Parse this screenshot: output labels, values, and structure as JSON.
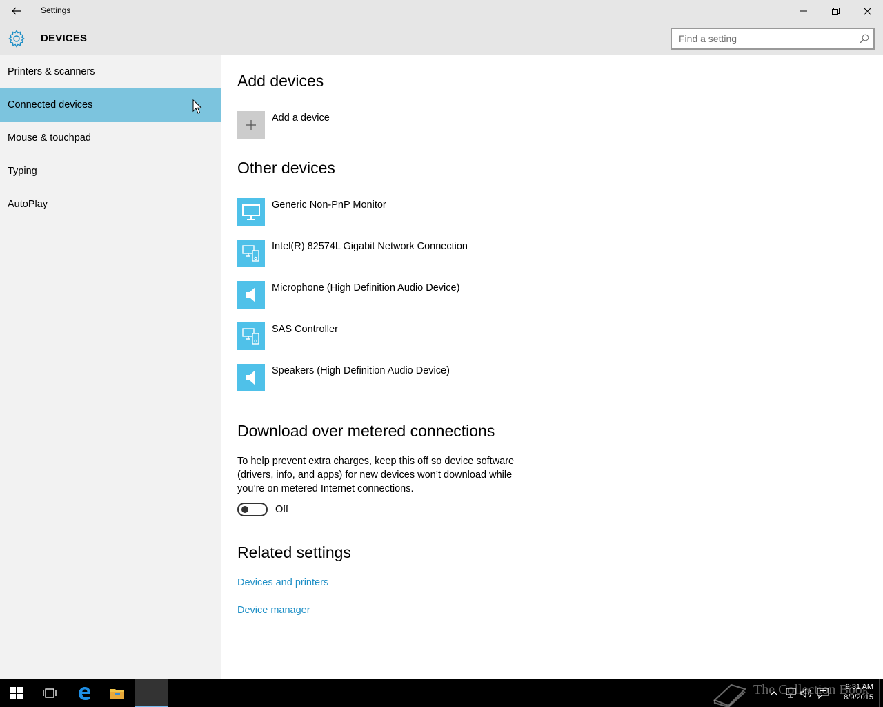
{
  "window": {
    "title": "Settings",
    "app_title": "DEVICES"
  },
  "search": {
    "placeholder": "Find a setting",
    "value": ""
  },
  "sidebar": {
    "items": [
      {
        "label": "Printers & scanners",
        "active": false
      },
      {
        "label": "Connected devices",
        "active": true
      },
      {
        "label": "Mouse & touchpad",
        "active": false
      },
      {
        "label": "Typing",
        "active": false
      },
      {
        "label": "AutoPlay",
        "active": false
      }
    ]
  },
  "main": {
    "add_devices": {
      "heading": "Add devices",
      "add_label": "Add a device"
    },
    "other_devices": {
      "heading": "Other devices",
      "devices": [
        {
          "name": "Generic Non-PnP Monitor",
          "icon": "monitor-icon"
        },
        {
          "name": "Intel(R) 82574L Gigabit Network Connection",
          "icon": "generic-device-icon"
        },
        {
          "name": "Microphone (High Definition Audio Device)",
          "icon": "speaker-icon"
        },
        {
          "name": "SAS Controller",
          "icon": "generic-device-icon"
        },
        {
          "name": "Speakers (High Definition Audio Device)",
          "icon": "speaker-icon"
        }
      ]
    },
    "metered": {
      "heading": "Download over metered connections",
      "description": "To help prevent extra charges, keep this off so device software (drivers, info, and apps) for new devices won’t download while you’re on metered Internet connections.",
      "toggle_state": "Off"
    },
    "related": {
      "heading": "Related settings",
      "links": [
        "Devices and printers",
        "Device manager"
      ]
    }
  },
  "taskbar": {
    "time": "9:31 AM",
    "date": "8/9/2015",
    "watermark": "The Collection Book"
  },
  "colors": {
    "accent": "#7cc4de",
    "tile_blue": "#4fc1e9",
    "link": "#1e8fc6",
    "sidebar_bg": "#f2f2f2",
    "titlebar_bg": "#e6e6e6"
  }
}
